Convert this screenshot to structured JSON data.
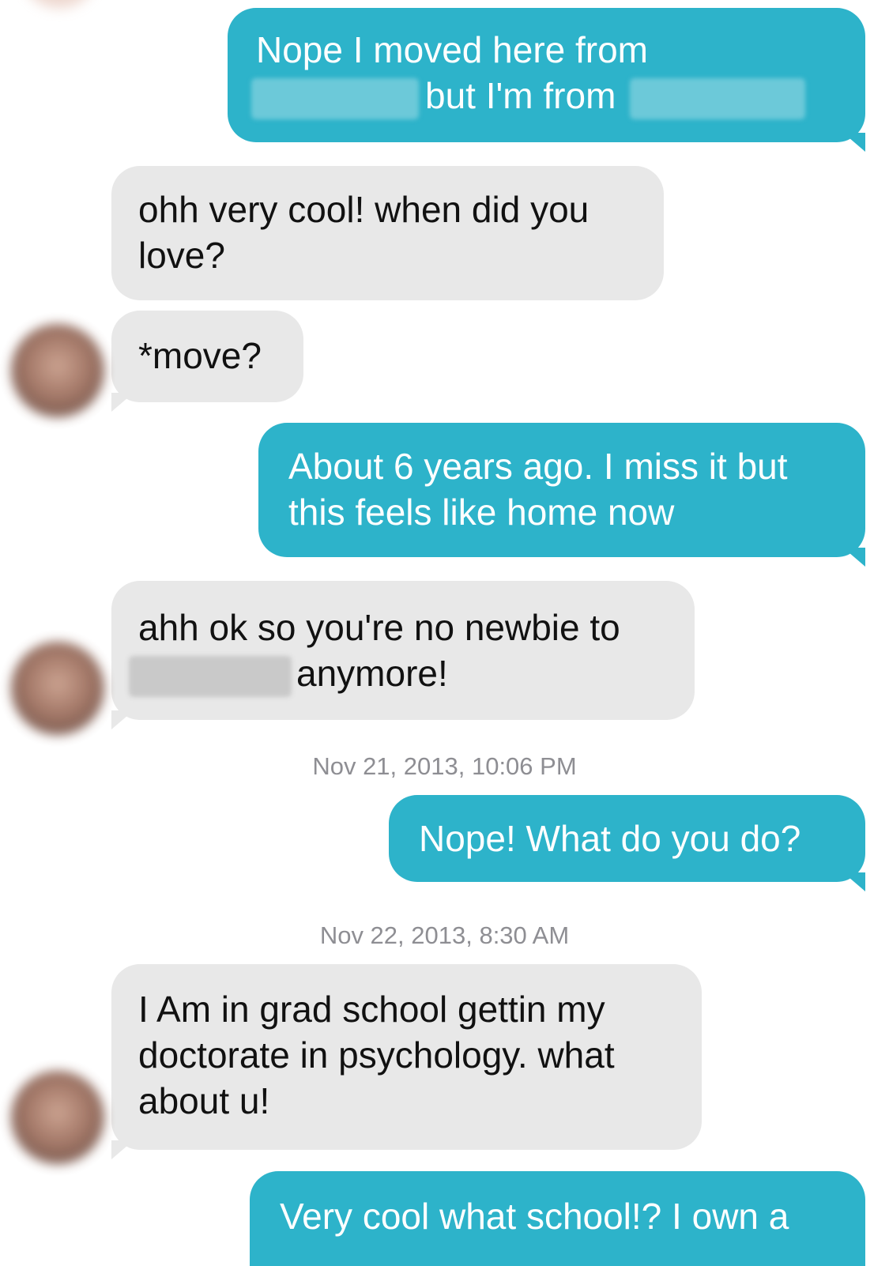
{
  "messages": [
    {
      "id": "m1",
      "side": "sent",
      "lines": [
        "Nope I moved here from",
        "but I'm from"
      ]
    },
    {
      "id": "m2",
      "side": "received",
      "lines": [
        "ohh very cool! when did you",
        "love?"
      ]
    },
    {
      "id": "m3",
      "side": "received",
      "lines": [
        "*move?"
      ]
    },
    {
      "id": "m4",
      "side": "sent",
      "lines": [
        "About 6 years ago. I miss it but",
        "this feels like home now"
      ]
    },
    {
      "id": "m5",
      "side": "received",
      "lines": [
        "ahh ok so you're no newbie to",
        "anymore!"
      ]
    },
    {
      "id": "m6",
      "side": "sent",
      "lines": [
        "Nope! What do you do?"
      ]
    },
    {
      "id": "m7",
      "side": "received",
      "lines": [
        "I Am in grad school gettin my",
        "doctorate in psychology. what",
        "about u!"
      ]
    },
    {
      "id": "m8",
      "side": "sent",
      "lines": [
        "Very cool what school!? I own a"
      ]
    }
  ],
  "timestamps": [
    "Nov 21, 2013, 10:06 PM",
    "Nov 22, 2013, 8:30 AM"
  ],
  "colors": {
    "sent_bubble": "#2db3ca",
    "received_bubble": "#e8e8e8",
    "timestamp_text": "#8e8e93"
  }
}
